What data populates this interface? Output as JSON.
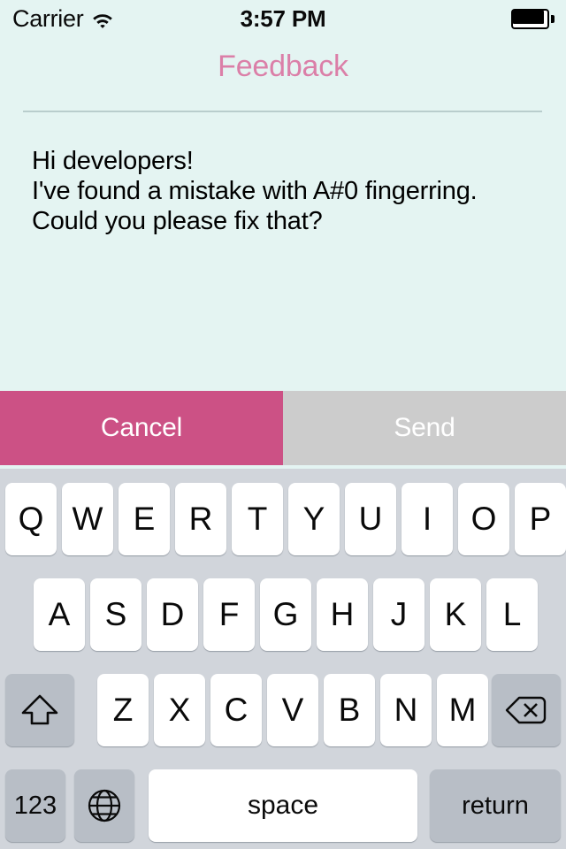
{
  "status_bar": {
    "carrier": "Carrier",
    "wifi_icon": "wifi-icon",
    "time": "3:57 PM",
    "battery_icon": "battery-full-icon"
  },
  "header": {
    "title": "Feedback",
    "title_color": "#db7fa8",
    "divider_color": "#b9cdcd"
  },
  "message": {
    "text": "Hi developers!\nI've found a mistake with A#0 fingerring.\nCould you please fix that?",
    "placeholder": "",
    "background": "#e4f4f2"
  },
  "actions": {
    "cancel_label": "Cancel",
    "cancel_color": "#cc5185",
    "send_label": "Send",
    "send_color": "#cccccc"
  },
  "keyboard": {
    "background": "#d1d5db",
    "row1": [
      "Q",
      "W",
      "E",
      "R",
      "T",
      "Y",
      "U",
      "I",
      "O",
      "P"
    ],
    "row2": [
      "A",
      "S",
      "D",
      "F",
      "G",
      "H",
      "J",
      "K",
      "L"
    ],
    "row3": [
      "Z",
      "X",
      "C",
      "V",
      "B",
      "N",
      "M"
    ],
    "shift_icon": "shift-arrow-icon",
    "delete_icon": "delete-backspace-icon",
    "numbers_label": "123",
    "globe_icon": "globe-icon",
    "space_label": "space",
    "return_label": "return"
  }
}
